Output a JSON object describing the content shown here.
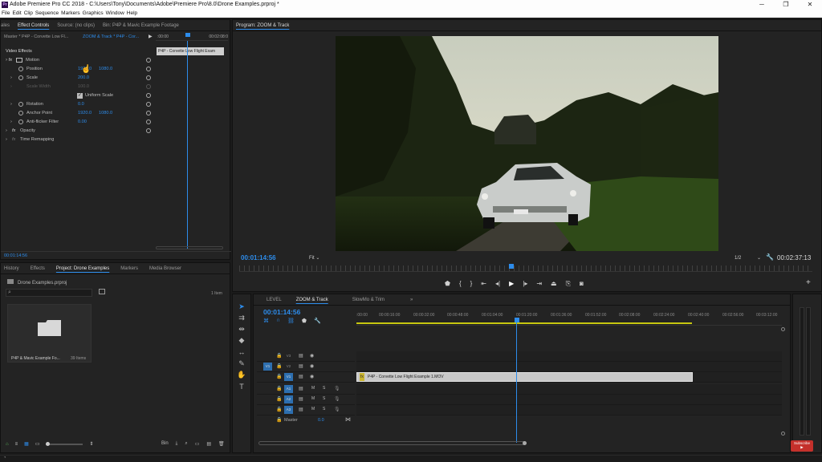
{
  "window": {
    "title": "Adobe Premiere Pro CC 2018 - C:\\Users\\Tony\\Documents\\Adobe\\Premiere Pro\\8.0\\Drone Examples.prproj *",
    "app_icon": "Pr",
    "min": "─",
    "max": "❐",
    "close": "✕"
  },
  "menu": [
    "File",
    "Edit",
    "Clip",
    "Sequence",
    "Markers",
    "Graphics",
    "Window",
    "Help"
  ],
  "source_panel": {
    "tabs": [
      "ales",
      "Effect Controls",
      "Source: (no clips)",
      "Bin: P4P & Mavic Example Footage"
    ],
    "master_label": "Master * P4P - Corvette Low Fl...",
    "sequence_label": "ZOOM & Track * P4P - Cor...",
    "ruler_start": ":00:00",
    "ruler_end": "00:02:08:0",
    "clip_label": "P4P - Corvette Low Flight Exam",
    "video_effects": "Video Effects",
    "motion": "Motion",
    "position_label": "Position",
    "position_x": "1920.0",
    "position_y": "1080.0",
    "scale_label": "Scale",
    "scale_value": "200.0",
    "scale_width_label": "Scale Width",
    "scale_width_value": "100.0",
    "uniform_scale": "Uniform Scale",
    "rotation_label": "Rotation",
    "rotation_value": "0.0",
    "anchor_label": "Anchor Point",
    "anchor_x": "1920.0",
    "anchor_y": "1080.0",
    "flicker_label": "Anti-flicker Filter",
    "flicker_value": "0.00",
    "opacity_label": "Opacity",
    "time_remap_label": "Time Remapping",
    "timecode": "00:01:14:56"
  },
  "program_panel": {
    "title": "Program: ZOOM & Track",
    "timecode": "00:01:14:56",
    "fit": "Fit",
    "resolution": "1/2",
    "duration": "00:02:37:13"
  },
  "project_panel": {
    "tabs": [
      "History",
      "Effects",
      "Project: Drone Examples",
      "Markers",
      "Media Browser"
    ],
    "project_file": "Drone Examples.prproj",
    "item_count": "1 Item",
    "bin_name": "P4P & Mavic Example Fo...",
    "bin_items": "39 Items",
    "bin_label": "Bin"
  },
  "timeline": {
    "tabs": [
      "LEVEL",
      "ZOOM & Track",
      "SlowMo & Trim",
      "»"
    ],
    "timecode": "00:01:14:56",
    "ruler": [
      ":00:00",
      "00:00:16:00",
      "00:00:32:00",
      "00:00:48:00",
      "00:01:04:00",
      "00:01:20:00",
      "00:01:36:00",
      "00:01:52:00",
      "00:02:08:00",
      "00:02:24:00",
      "00:02:40:00",
      "00:02:56:00",
      "00:03:12:00"
    ],
    "video_tracks": [
      "V3",
      "V2",
      "V1"
    ],
    "audio_tracks": [
      "A1",
      "A2",
      "A3"
    ],
    "source_patch_v": "V1",
    "m_label": "M",
    "s_label": "S",
    "master_label": "Master",
    "master_value": "0.0",
    "clip_name": "P4P - Corvette Low Flight Example 1.MOV",
    "clip_fx": "fx"
  },
  "subscribe": "Subscribe",
  "colors": {
    "accent": "#2d8ceb",
    "panel": "#232323",
    "clip": "#c8c8c8"
  }
}
